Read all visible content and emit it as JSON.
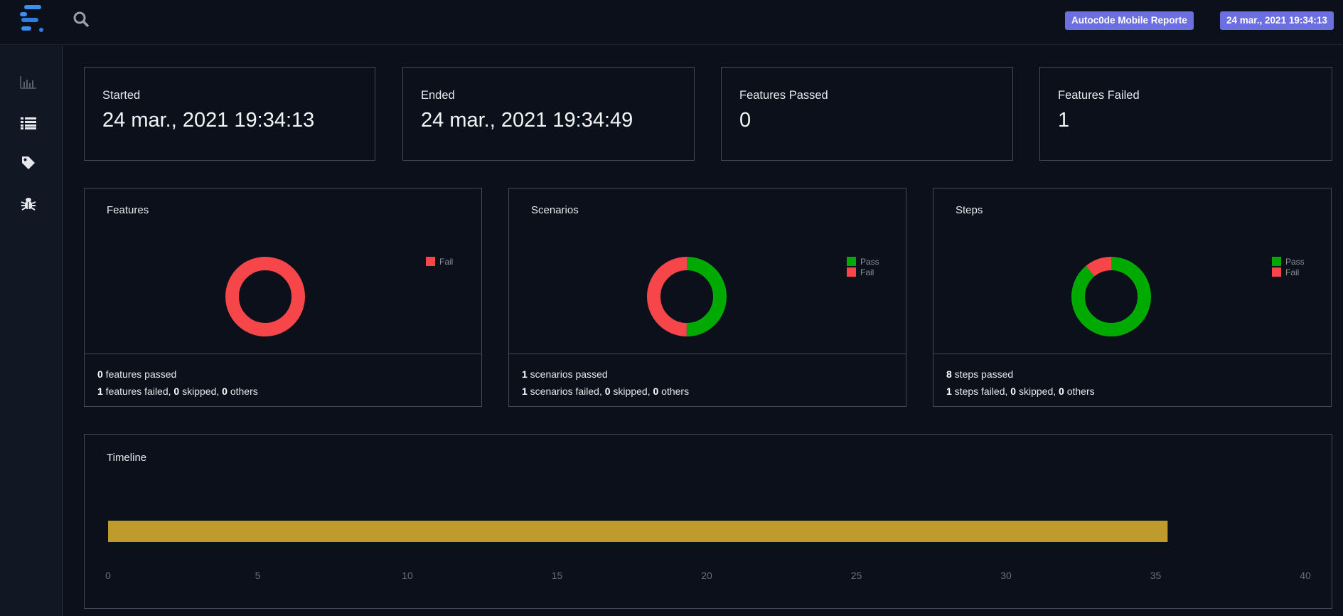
{
  "header": {
    "report_badge": "Autoc0de Mobile Reporte",
    "date_badge": "24 mar., 2021 19:34:13",
    "logo_icon": "extent-logo-icon",
    "search_icon": "search-icon"
  },
  "sidebar": {
    "items": [
      {
        "icon": "dashboard-chart-icon"
      },
      {
        "icon": "list-icon"
      },
      {
        "icon": "tag-icon"
      },
      {
        "icon": "bug-icon"
      }
    ]
  },
  "stats": [
    {
      "label": "Started",
      "value": "24 mar., 2021 19:34:13"
    },
    {
      "label": "Ended",
      "value": "24 mar., 2021 19:34:49"
    },
    {
      "label": "Features Passed",
      "value": "0"
    },
    {
      "label": "Features Failed",
      "value": "1"
    }
  ],
  "colors": {
    "pass": "#00aa00",
    "fail": "#f7464a",
    "timeline_bar": "#bf9b2d",
    "badge": "#6c6fe0"
  },
  "charts": {
    "features": {
      "title": "Features",
      "legend": [
        "Fail"
      ],
      "summary": {
        "passed_count": "0",
        "passed_text": " features passed",
        "failed_count": "1",
        "failed_text": " features failed, ",
        "skipped_count": "0",
        "skipped_text": " skipped, ",
        "others_count": "0",
        "others_text": " others"
      }
    },
    "scenarios": {
      "title": "Scenarios",
      "legend": [
        "Pass",
        "Fail"
      ],
      "summary": {
        "passed_count": "1",
        "passed_text": " scenarios passed",
        "failed_count": "1",
        "failed_text": " scenarios failed, ",
        "skipped_count": "0",
        "skipped_text": " skipped, ",
        "others_count": "0",
        "others_text": " others"
      }
    },
    "steps": {
      "title": "Steps",
      "legend": [
        "Pass",
        "Fail"
      ],
      "summary": {
        "passed_count": "8",
        "passed_text": " steps passed",
        "failed_count": "1",
        "failed_text": " steps failed, ",
        "skipped_count": "0",
        "skipped_text": " skipped, ",
        "others_count": "0",
        "others_text": " others"
      }
    }
  },
  "timeline": {
    "title": "Timeline"
  },
  "chart_data": [
    {
      "type": "pie",
      "title": "Features",
      "categories": [
        "Fail"
      ],
      "values": [
        1
      ]
    },
    {
      "type": "pie",
      "title": "Scenarios",
      "categories": [
        "Pass",
        "Fail"
      ],
      "values": [
        1,
        1
      ]
    },
    {
      "type": "pie",
      "title": "Steps",
      "categories": [
        "Pass",
        "Fail"
      ],
      "values": [
        8,
        1
      ]
    },
    {
      "type": "bar",
      "title": "Timeline",
      "orientation": "horizontal",
      "values": [
        35.4
      ],
      "xlim": [
        0,
        40
      ],
      "xticks": [
        0,
        5,
        10,
        15,
        20,
        25,
        30,
        35,
        40
      ]
    }
  ]
}
